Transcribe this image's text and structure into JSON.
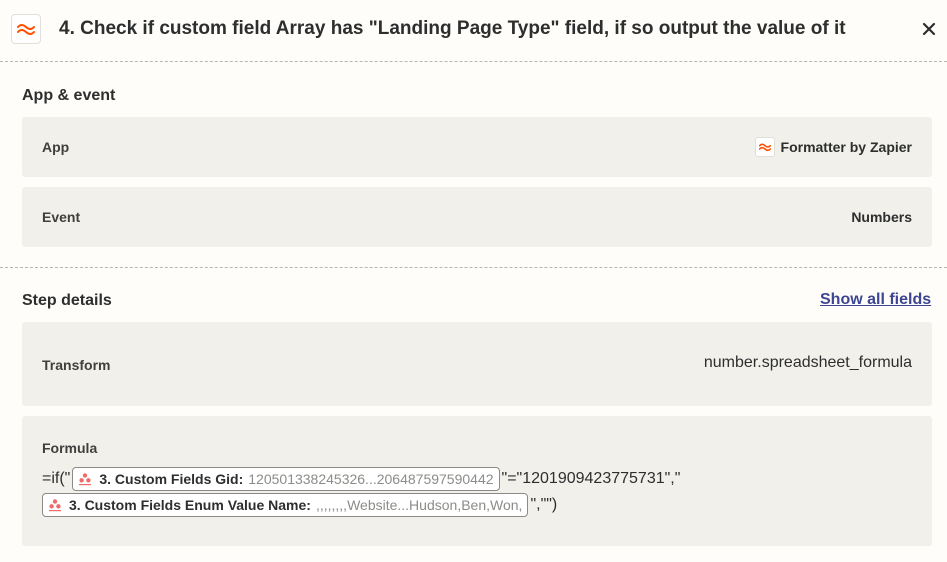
{
  "header": {
    "title": "4. Check if custom field Array has \"Landing Page Type\" field, if so output the value of it",
    "app_icon": "formatter-icon",
    "close_icon": "close-icon"
  },
  "app_event": {
    "section_title": "App & event",
    "app_label": "App",
    "app_value": "Formatter by Zapier",
    "event_label": "Event",
    "event_value": "Numbers"
  },
  "step_details": {
    "section_title": "Step details",
    "show_all_label": "Show all fields",
    "transform_label": "Transform",
    "transform_value": "number.spreadsheet_formula",
    "formula_label": "Formula",
    "formula": {
      "prefix": "=if(\"",
      "pill1_label": "3. Custom Fields Gid:",
      "pill1_value": "120501338245326...206487597590442",
      "middle": "\"=\"1201909423775731\",\"",
      "pill2_label": "3. Custom Fields Enum Value Name:",
      "pill2_value": ",,,,,,,,Website...Hudson,Ben,Won,",
      "suffix": "\",\"\")"
    }
  },
  "colors": {
    "accent_orange": "#ff4f00",
    "link": "#3d4592",
    "row_bg": "#f2f0eb",
    "page_bg": "#fffdf9",
    "asana": "#f06a6a"
  }
}
